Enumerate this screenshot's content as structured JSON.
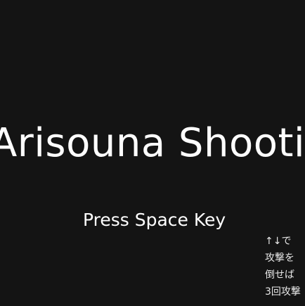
{
  "game": {
    "title": "Arisouna Shooting",
    "prompt": "Press Space Key",
    "instructions": [
      "↑↓で",
      "攻撃を",
      "倒せば",
      "3回攻撃"
    ]
  },
  "colors": {
    "background": "#141414",
    "text": "#ffffff"
  }
}
